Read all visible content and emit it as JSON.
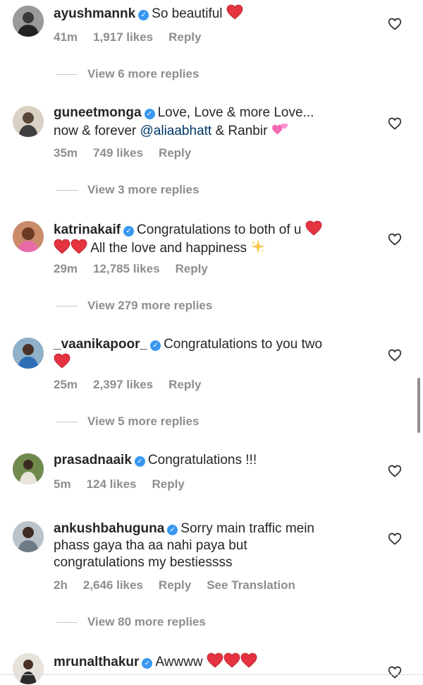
{
  "comments": [
    {
      "user": "ayushmannk",
      "parts": [
        {
          "t": "So beautiful"
        }
      ],
      "time": "41m",
      "likes": "1,917 likes",
      "reply": "Reply",
      "replies": "View 6 more replies"
    },
    {
      "user": "guneetmonga",
      "line1": "Love, Love & more Love...",
      "line2_pre": "now & forever ",
      "mention": "@aliaabhatt",
      "line2_post": " & Ranbir",
      "time": "35m",
      "likes": "749 likes",
      "reply": "Reply",
      "replies": "View 3 more replies"
    },
    {
      "user": "katrinakaif",
      "line1": "Congratulations to both of u",
      "line2": "All the love and happiness",
      "time": "29m",
      "likes": "12,785 likes",
      "reply": "Reply",
      "replies": "View 279 more replies"
    },
    {
      "user": "_vaanikapoor_",
      "line1": "Congratulations to you two",
      "time": "25m",
      "likes": "2,397 likes",
      "reply": "Reply",
      "replies": "View 5 more replies"
    },
    {
      "user": "prasadnaaik",
      "line1": "Congratulations !!!",
      "time": "5m",
      "likes": "124 likes",
      "reply": "Reply"
    },
    {
      "user": "ankushbahuguna",
      "line1": "Sorry main traffic mein",
      "line2": "phass gaya tha aa nahi paya but",
      "line3": "congratulations my bestiessss",
      "time": "2h",
      "likes": "2,646 likes",
      "reply": "Reply",
      "translation": "See Translation",
      "replies": "View 80 more replies"
    },
    {
      "user": "mrunalthakur",
      "line1": "Awwww"
    }
  ],
  "icons": {
    "verified": "verified-badge-icon",
    "like": "heart-outline-icon",
    "red_heart": "red-heart-emoji",
    "pink_hearts": "two-hearts-emoji",
    "sparkle": "star-sparkle-emoji"
  },
  "colors": {
    "text": "#262626",
    "meta": "#8e8e8e",
    "verified": "#3897f0",
    "mention": "#00376b",
    "heart_emoji": "#e0245e"
  }
}
